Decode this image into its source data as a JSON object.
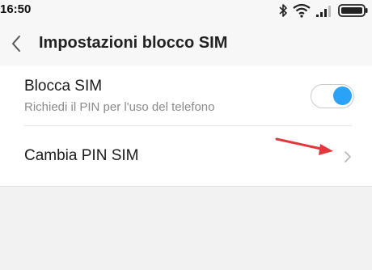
{
  "status_bar": {
    "time": "16:50",
    "icons": [
      "bluetooth-icon",
      "wifi-icon",
      "signal-icon",
      "battery-icon"
    ]
  },
  "header": {
    "title": "Impostazioni blocco SIM",
    "back_icon": "chevron-left-icon"
  },
  "settings": {
    "sim_lock": {
      "title": "Blocca SIM",
      "subtitle": "Richiedi il PIN per l'uso del telefono",
      "enabled": true
    },
    "change_pin": {
      "title": "Cambia PIN SIM",
      "icon": "chevron-right-icon"
    }
  },
  "colors": {
    "accent": "#2aa2f5",
    "annotation_arrow": "#e0383c",
    "background": "#f2f2f2"
  }
}
